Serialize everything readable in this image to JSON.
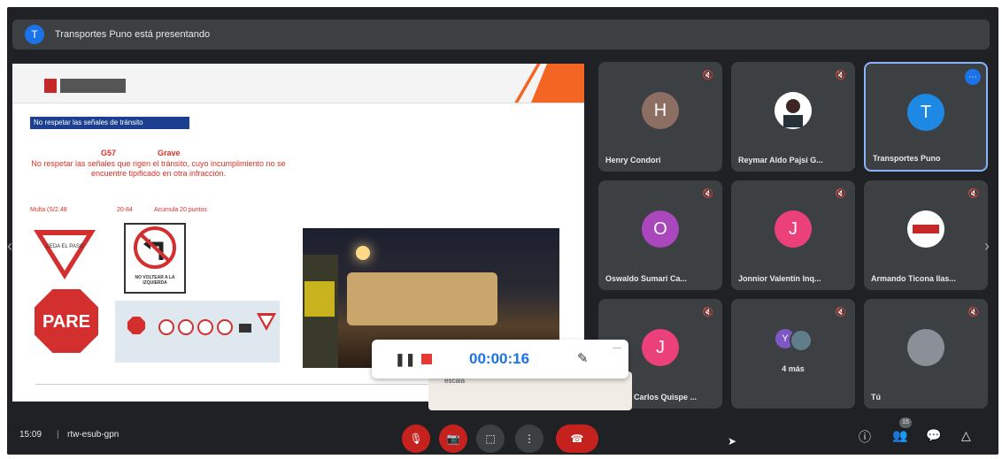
{
  "banner": {
    "avatar_letter": "T",
    "text": "Transportes Puno está presentando"
  },
  "slide": {
    "heading_box": "No respetar las señales de tránsito",
    "code": "G57",
    "severity": "Grave",
    "description": "No respetar las señales que rigen el tránsito, cuyo incumplimiento no se encuentre tipificado en otra infracción.",
    "fine": "Multa (S/2.48",
    "points": "20-84",
    "accumulation": "Acumula 20 puntos",
    "yield_sign_text": "CEDA EL PASO",
    "stop_sign_text": "PARE",
    "noturn_text": "NO VOLTEAR A LA IZQUIERDA"
  },
  "participants": [
    {
      "name": "Henry Condori",
      "letter": "H",
      "color": "#8d6e63"
    },
    {
      "name": "Reymar Aldo Pajsi G...",
      "letter": "",
      "color": "#ffffff"
    },
    {
      "name": "Transportes Puno",
      "letter": "T",
      "color": "#1e88e5"
    },
    {
      "name": "Oswaldo Sumari Ca...",
      "letter": "O",
      "color": "#ab47bc"
    },
    {
      "name": "Jonnior Valentín Inq...",
      "letter": "J",
      "color": "#ec407a"
    },
    {
      "name": "Armando Ticona Ilas...",
      "letter": "",
      "color": "#ffffff"
    },
    {
      "name": "Carlos Quispe ...",
      "letter": "J",
      "color": "#ec407a"
    },
    {
      "name": "4 más",
      "letter": "Y",
      "color": "#7e57c2"
    },
    {
      "name": "Tú",
      "letter": "",
      "color": "#8a8f98"
    }
  ],
  "recorder": {
    "time": "00:00:16"
  },
  "popup": {
    "text": "escala"
  },
  "bottom": {
    "time": "15:09",
    "separator": "|",
    "meeting_code": "rtw-esub-gpn",
    "people_count": "15"
  },
  "icons": {
    "mic": "mic-off-icon",
    "cam": "camera-off-icon",
    "present": "present-icon",
    "more": "more-vertical-icon",
    "end": "end-call-icon",
    "info": "info-icon",
    "people": "people-icon",
    "chat": "chat-icon",
    "activities": "activities-icon"
  }
}
